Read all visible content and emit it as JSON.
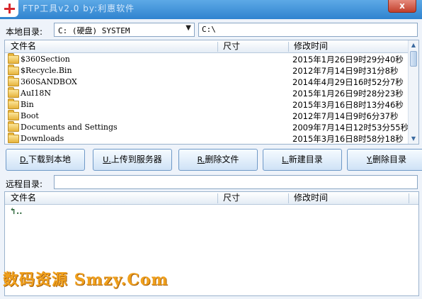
{
  "window": {
    "title": "FTP工具v2.0 by:利惠软件",
    "close_label": "x"
  },
  "local": {
    "label": "本地目录:",
    "drive_value": "C: (硬盘) SYSTEM",
    "path_value": "C:\\"
  },
  "columns": {
    "name": "文件名",
    "size": "尺寸",
    "modified": "修改时间"
  },
  "local_files": [
    {
      "name": "$360Section",
      "modified": "2015年1月26日9时29分40秒"
    },
    {
      "name": "$Recycle.Bin",
      "modified": "2012年7月14日9时31分8秒"
    },
    {
      "name": "360SANDBOX",
      "modified": "2014年4月29日16时52分7秒"
    },
    {
      "name": "AuI18N",
      "modified": "2015年1月26日9时28分23秒"
    },
    {
      "name": "Bin",
      "modified": "2015年3月16日8时13分46秒"
    },
    {
      "name": "Boot",
      "modified": "2012年7月14日9时6分37秒"
    },
    {
      "name": "Documents and Settings",
      "modified": "2009年7月14日12时53分55秒"
    },
    {
      "name": "Downloads",
      "modified": "2015年3月16日8时58分18秒"
    }
  ],
  "buttons": [
    {
      "key": "D.",
      "label": "下载到本地"
    },
    {
      "key": "U.",
      "label": "上传到服务器"
    },
    {
      "key": "R.",
      "label": "删除文件"
    },
    {
      "key": "L.",
      "label": "新建目录"
    },
    {
      "key": "Y.",
      "label": "删除目录"
    }
  ],
  "remote": {
    "label": "远程目录:",
    "path_value": "",
    "parent_entry": "↰.."
  },
  "watermark": "数码资源 Smzy.Com",
  "icons": {
    "app": "app-icon",
    "folder": "folder-icon",
    "dropdown": "chevron-down-icon"
  },
  "colors": {
    "titlebar": "#2f83cf",
    "button_border": "#6f99c7",
    "watermark": "#f0a01c"
  }
}
